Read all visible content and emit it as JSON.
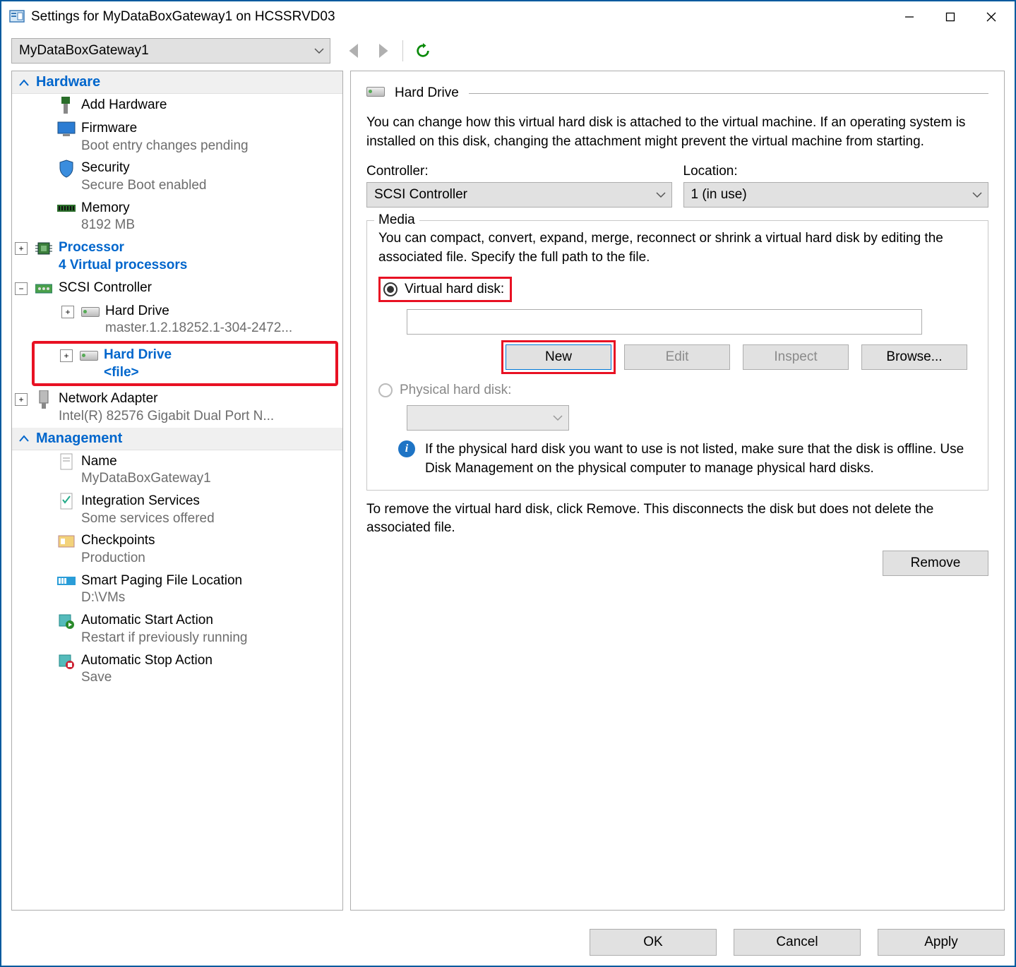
{
  "window": {
    "title": "Settings for MyDataBoxGateway1 on HCSSRVD03"
  },
  "toolbar": {
    "vm_name": "MyDataBoxGateway1"
  },
  "sections": {
    "hardware": {
      "title": "Hardware",
      "add_hardware": "Add Hardware",
      "firmware": {
        "label": "Firmware",
        "sub": "Boot entry changes pending"
      },
      "security": {
        "label": "Security",
        "sub": "Secure Boot enabled"
      },
      "memory": {
        "label": "Memory",
        "sub": "8192 MB"
      },
      "processor": {
        "label": "Processor",
        "sub": "4 Virtual processors"
      },
      "scsi": {
        "label": "SCSI Controller"
      },
      "hd1": {
        "label": "Hard Drive",
        "sub": "master.1.2.18252.1-304-2472..."
      },
      "hd2": {
        "label": "Hard Drive",
        "sub": "<file>"
      },
      "net": {
        "label": "Network Adapter",
        "sub": "Intel(R) 82576 Gigabit Dual Port N..."
      }
    },
    "management": {
      "title": "Management",
      "name": {
        "label": "Name",
        "sub": "MyDataBoxGateway1"
      },
      "integ": {
        "label": "Integration Services",
        "sub": "Some services offered"
      },
      "checkpoints": {
        "label": "Checkpoints",
        "sub": "Production"
      },
      "smart": {
        "label": "Smart Paging File Location",
        "sub": "D:\\VMs"
      },
      "autostart": {
        "label": "Automatic Start Action",
        "sub": "Restart if previously running"
      },
      "autostop": {
        "label": "Automatic Stop Action",
        "sub": "Save"
      }
    }
  },
  "detail": {
    "title": "Hard Drive",
    "desc": "You can change how this virtual hard disk is attached to the virtual machine. If an operating system is installed on this disk, changing the attachment might prevent the virtual machine from starting.",
    "controller_label": "Controller:",
    "controller_value": "SCSI Controller",
    "location_label": "Location:",
    "location_value": "1 (in use)",
    "media_legend": "Media",
    "media_desc": "You can compact, convert, expand, merge, reconnect or shrink a virtual hard disk by editing the associated file. Specify the full path to the file.",
    "radio_vhd": "Virtual hard disk:",
    "radio_phys": "Physical hard disk:",
    "btn_new": "New",
    "btn_edit": "Edit",
    "btn_inspect": "Inspect",
    "btn_browse": "Browse...",
    "info_text": "If the physical hard disk you want to use is not listed, make sure that the disk is offline. Use Disk Management on the physical computer to manage physical hard disks.",
    "remove_desc": "To remove the virtual hard disk, click Remove. This disconnects the disk but does not delete the associated file.",
    "btn_remove": "Remove"
  },
  "footer": {
    "ok": "OK",
    "cancel": "Cancel",
    "apply": "Apply"
  }
}
